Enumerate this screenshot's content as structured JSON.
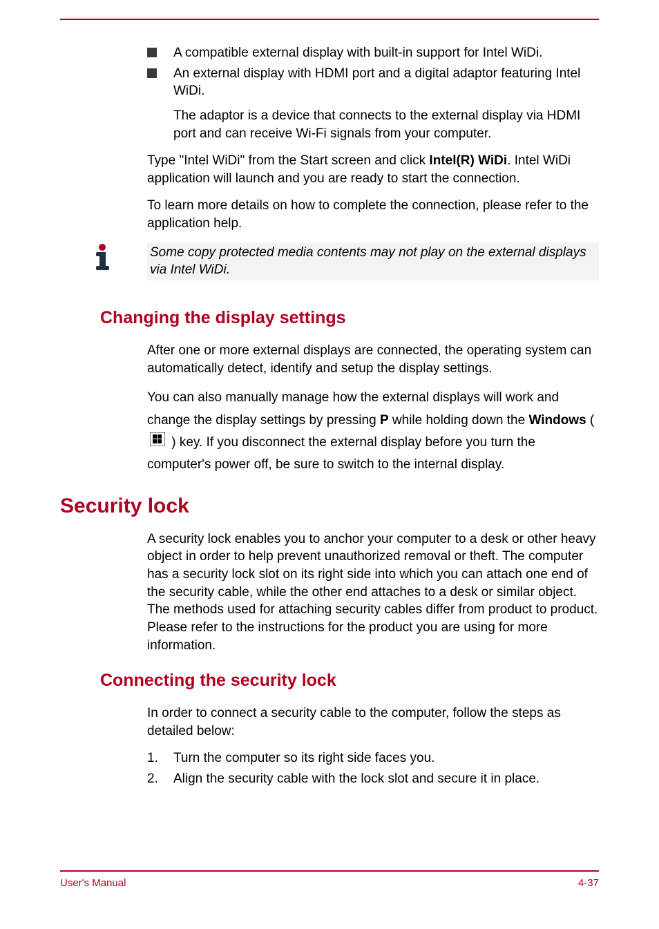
{
  "bullets": {
    "b1": "A compatible external display with built-in support for Intel WiDi.",
    "b2": "An external display with HDMI port and a digital adaptor featuring Intel WiDi."
  },
  "sub_adaptor": "The adaptor is a device that connects to the external display via HDMI port and can receive Wi-Fi signals from your computer.",
  "type_intel": {
    "prefix": "Type \"Intel WiDi\" from the Start screen and click ",
    "bold": "Intel(R) WiDi",
    "suffix": ". Intel WiDi application will launch and you are ready to start the connection."
  },
  "learn_more": "To learn more details on how to complete the connection, please refer to the application help.",
  "note_text": "Some copy protected media contents may not play on the external displays via Intel WiDi.",
  "heading_changing": "Changing the display settings",
  "changing_p1": "After one or more external displays are connected, the operating system can automatically detect, identify and setup the display settings.",
  "changing_p2": {
    "t1": "You can also manually manage how the external displays will work and change the display settings by pressing ",
    "p_bold": "P",
    "t2": " while holding down the ",
    "win_bold": "Windows",
    "t3": " ( ",
    "t4": " ) key. If you disconnect the external display before you turn the computer's power off, be sure to switch to the internal display."
  },
  "heading_security": "Security lock",
  "security_p": "A security lock enables you to anchor your computer to a desk or other heavy object in order to help prevent unauthorized removal or theft. The computer has a security lock slot on its right side into which you can attach one end of the security cable, while the other end attaches to a desk or similar object. The methods used for attaching security cables differ from product to product. Please refer to the instructions for the product you are using for more information.",
  "heading_connecting": "Connecting the security lock",
  "connecting_p": "In order to connect a security cable to the computer, follow the steps as detailed below:",
  "steps": {
    "n1": "1.",
    "s1": "Turn the computer so its right side faces you.",
    "n2": "2.",
    "s2": "Align the security cable with the lock slot and secure it in place."
  },
  "footer": {
    "left": "User's Manual",
    "right": "4-37"
  }
}
